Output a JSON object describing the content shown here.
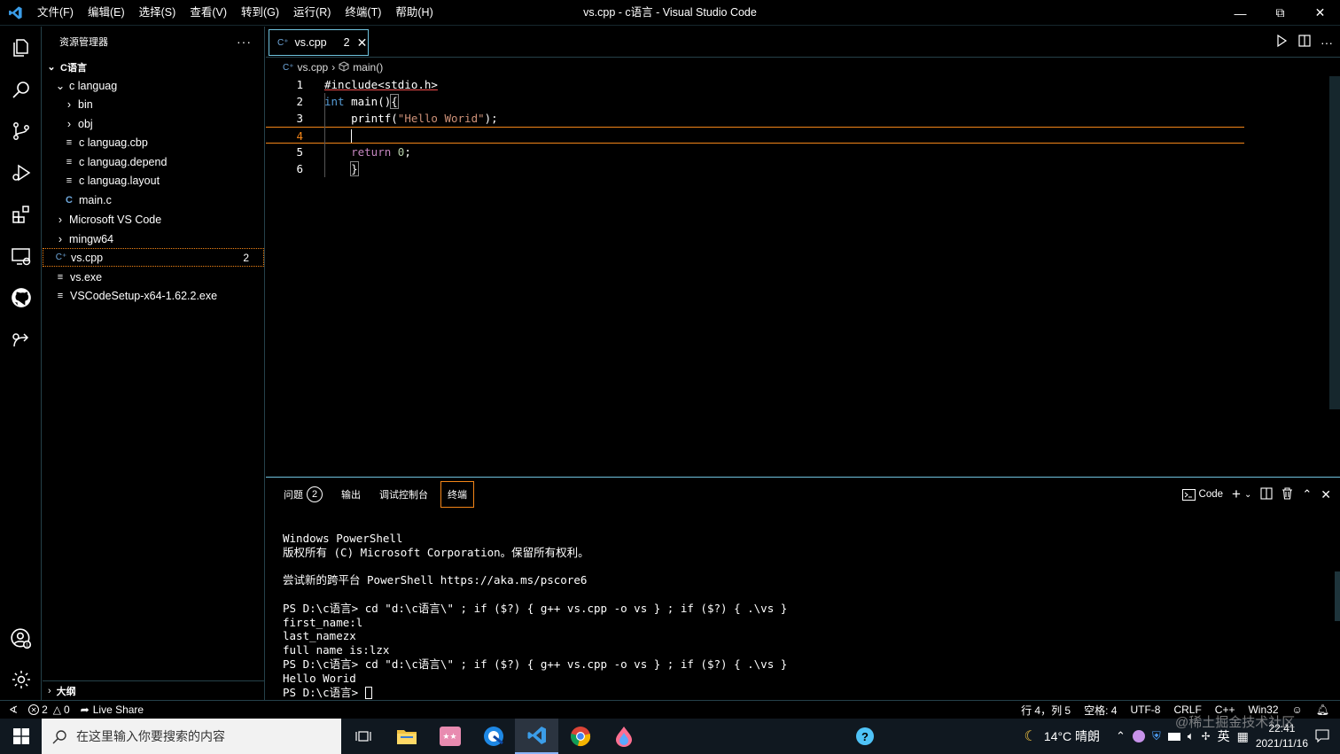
{
  "titlebar": {
    "menu": [
      "文件(F)",
      "编辑(E)",
      "选择(S)",
      "查看(V)",
      "转到(G)",
      "运行(R)",
      "终端(T)",
      "帮助(H)"
    ],
    "title": "vs.cpp - c语言 - Visual Studio Code"
  },
  "sidebar": {
    "header": "资源管理器",
    "root": "C语言",
    "items": [
      {
        "label": "c languag",
        "kind": "folder-open"
      },
      {
        "label": "bin",
        "kind": "folder"
      },
      {
        "label": "obj",
        "kind": "folder"
      },
      {
        "label": "c languag.cbp",
        "kind": "file"
      },
      {
        "label": "c languag.depend",
        "kind": "file"
      },
      {
        "label": "c languag.layout",
        "kind": "file"
      },
      {
        "label": "main.c",
        "kind": "c-file"
      },
      {
        "label": "Microsoft VS Code",
        "kind": "folder"
      },
      {
        "label": "mingw64",
        "kind": "folder"
      },
      {
        "label": "vs.cpp",
        "kind": "cpp-file",
        "badge": "2"
      },
      {
        "label": "vs.exe",
        "kind": "file"
      },
      {
        "label": "VSCodeSetup-x64-1.62.2.exe",
        "kind": "file"
      }
    ],
    "outline": "大纲"
  },
  "tabs": [
    {
      "label": "vs.cpp",
      "badge": "2"
    }
  ],
  "breadcrumb": {
    "file": "vs.cpp",
    "symbol": "main()"
  },
  "editor": {
    "lines": [
      {
        "num": "1",
        "text": "#include<stdio.h>"
      },
      {
        "num": "2",
        "text": "int main(){"
      },
      {
        "num": "3",
        "text": "    printf(\"Hello Worid\");"
      },
      {
        "num": "4",
        "text": "    "
      },
      {
        "num": "5",
        "text": "    return 0;"
      },
      {
        "num": "6",
        "text": "    }"
      }
    ]
  },
  "panel": {
    "tabs": [
      {
        "label": "问题",
        "badge": "2"
      },
      {
        "label": "输出"
      },
      {
        "label": "调试控制台"
      },
      {
        "label": "终端",
        "active": true
      }
    ],
    "shell_label": "Code",
    "terminal_lines": [
      "Windows PowerShell",
      "版权所有 (C) Microsoft Corporation。保留所有权利。",
      "",
      "尝试新的跨平台 PowerShell https://aka.ms/pscore6",
      "",
      "PS D:\\c语言> cd \"d:\\c语言\\\" ; if ($?) { g++ vs.cpp -o vs } ; if ($?) { .\\vs }",
      "first_name:l",
      "last_namezx",
      "full name is:lzx",
      "PS D:\\c语言> cd \"d:\\c语言\\\" ; if ($?) { g++ vs.cpp -o vs } ; if ($?) { .\\vs }",
      "Hello Worid",
      "PS D:\\c语言> "
    ]
  },
  "statusbar": {
    "errors": "2",
    "warnings": "0",
    "liveshare": "Live Share",
    "position": "行 4，列 5",
    "spaces": "空格: 4",
    "encoding": "UTF-8",
    "eol": "CRLF",
    "language": "C++",
    "platform": "Win32"
  },
  "taskbar": {
    "search_placeholder": "在这里输入你要搜索的内容",
    "weather": "14°C 晴朗",
    "ime": "英",
    "time": "22:41",
    "date": "2021/11/16"
  },
  "watermark": "@稀土掘金技术社区",
  "colors": {
    "accent": "#f38518",
    "border": "#6fc3df",
    "keyword": "#569cd6",
    "string": "#ce9178"
  }
}
